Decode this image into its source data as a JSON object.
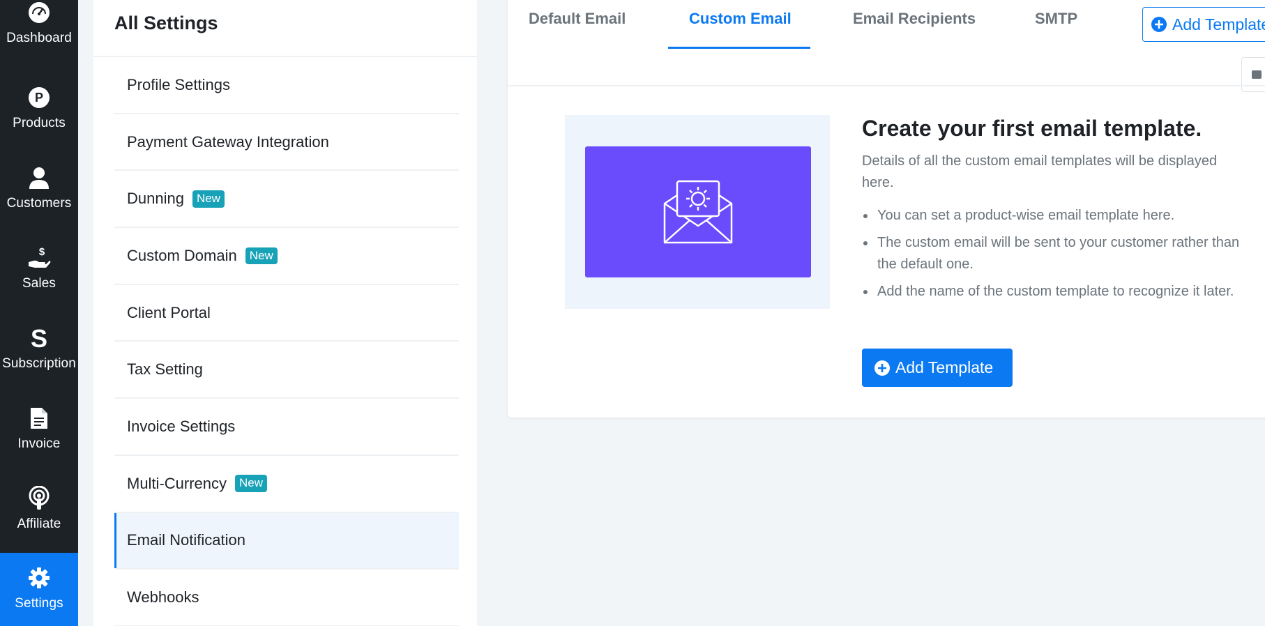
{
  "sidebar": {
    "items": [
      {
        "label": "Dashboard",
        "icon": "dashboard-gauge-icon"
      },
      {
        "label": "Products",
        "icon": "products-p-icon"
      },
      {
        "label": "Customers",
        "icon": "user-icon"
      },
      {
        "label": "Sales",
        "icon": "hand-dollar-icon"
      },
      {
        "label": "Subscription",
        "icon": "subscription-s-icon"
      },
      {
        "label": "Invoice",
        "icon": "document-icon"
      },
      {
        "label": "Affiliate",
        "icon": "broadcast-icon"
      },
      {
        "label": "Settings",
        "icon": "gear-icon"
      }
    ],
    "active": "Settings"
  },
  "settings": {
    "title": "All Settings",
    "items": [
      {
        "label": "Profile Settings",
        "badge": ""
      },
      {
        "label": "Payment Gateway Integration",
        "badge": ""
      },
      {
        "label": "Dunning",
        "badge": "New"
      },
      {
        "label": "Custom Domain",
        "badge": "New"
      },
      {
        "label": "Client Portal",
        "badge": ""
      },
      {
        "label": "Tax Setting",
        "badge": ""
      },
      {
        "label": "Invoice Settings",
        "badge": ""
      },
      {
        "label": "Multi-Currency",
        "badge": "New"
      },
      {
        "label": "Email Notification",
        "badge": ""
      },
      {
        "label": "Webhooks",
        "badge": ""
      }
    ],
    "active": "Email Notification"
  },
  "tabs": [
    {
      "label": "Default Email"
    },
    {
      "label": "Custom Email"
    },
    {
      "label": "Email Recipients"
    },
    {
      "label": "SMTP"
    }
  ],
  "active_tab": "Custom Email",
  "header_button": {
    "label": "Add Template"
  },
  "empty_state": {
    "title": "Create your first email template.",
    "description": "Details of all the custom email templates will be displayed here.",
    "bullets": [
      "You can set a product-wise email template here.",
      "The custom email will be sent to your customer rather than the default one.",
      "Add the name of the custom template to recognize it later."
    ],
    "button_label": "Add Template"
  },
  "colors": {
    "primary": "#0b79f2",
    "rail_bg": "#1d2227",
    "illustration_bg": "#6a4cfc",
    "badge": "#17a2b8"
  }
}
